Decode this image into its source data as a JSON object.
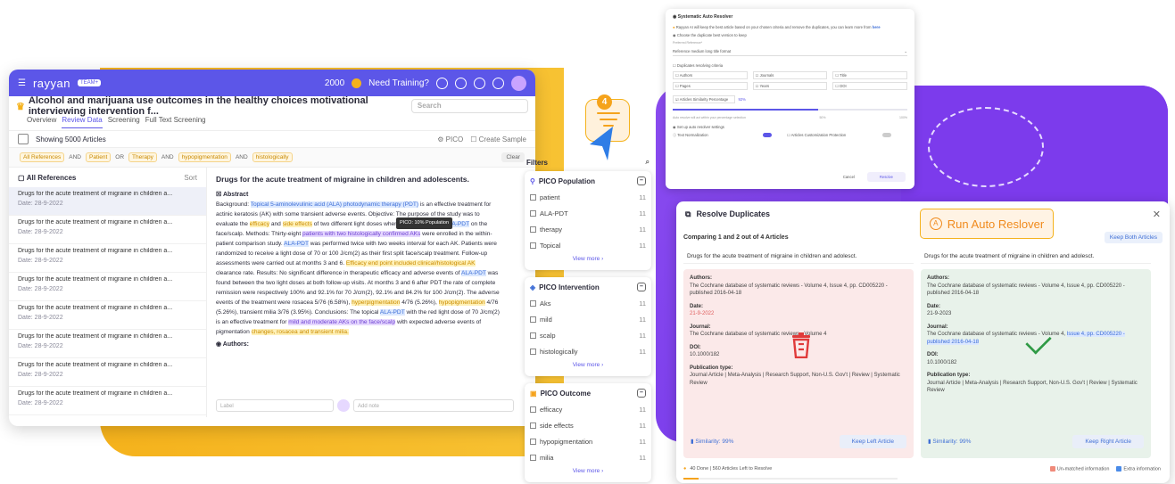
{
  "app": {
    "brand": "rayyan",
    "badge": "TEAM+",
    "coins": "2000",
    "training": "Need Training?",
    "review_title": "Alcohol and marijuana use outcomes in the healthy choices motivational interviewing intervention f...",
    "search_placeholder": "Search",
    "tabs": [
      "Overview",
      "Review Data",
      "Screening",
      "Full Text Screening"
    ],
    "showing": "Showing 5000 Articles",
    "pico_btn": "PICO",
    "create_sample": "Create Sample",
    "filters_chips": [
      "All References",
      "Patient",
      "Therapy",
      "hypopigmentation",
      "histologically"
    ],
    "ops": [
      "AND",
      "OR",
      "AND",
      "AND"
    ],
    "clear": "Clear",
    "all_refs": "All References",
    "sort": "Sort",
    "articles": [
      {
        "title": "Drugs for the acute treatment of migraine in children a...",
        "date": "Date: 28-9-2022"
      },
      {
        "title": "Drugs for the acute treatment of migraine in children a...",
        "date": "Date: 28-9-2022"
      },
      {
        "title": "Drugs for the acute treatment of migraine in children a...",
        "date": "Date: 28-9-2022"
      },
      {
        "title": "Drugs for the acute treatment of migraine in children a...",
        "date": "Date: 28-9-2022"
      },
      {
        "title": "Drugs for the acute treatment of migraine in children a...",
        "date": "Date: 28-9-2022"
      },
      {
        "title": "Drugs for the acute treatment of migraine in children a...",
        "date": "Date: 28-9-2022"
      },
      {
        "title": "Drugs for the acute treatment of migraine in children a...",
        "date": "Date: 28-9-2022"
      },
      {
        "title": "Drugs for the acute treatment of migraine in children a...",
        "date": "Date: 28-9-2022"
      }
    ],
    "detail_title": "Drugs for the acute treatment of migraine in children and adolescents.",
    "abstract_label": "Abstract",
    "tooltip": "PICO: 10% Population",
    "authors_label": "Authors:",
    "label_placeholder": "Label",
    "note_placeholder": "Add note",
    "abstract": {
      "p1": "Background: ",
      "h1": "Topical 5-aminolevulinic acid (ALA) photodynamic therapy (PDT)",
      "p2": " is an effective treatment for actinic keratosis (AK) with some transient adverse events. Objective: The purpose of the study was to evaluate the ",
      "h2": "efficacy",
      "p3": " and ",
      "h3": "side effects",
      "p4": " of two different light doses when treating AKs with ",
      "h4": "ALA-PDT",
      "p5": " on the face/scalp. Methods: Thirty-eight ",
      "h5": "patients with two histologically confirmed AKs",
      "p6": " were enrolled in the within-patient comparison study. ",
      "h6": "ALA-PDT",
      "p7": " was performed twice with two weeks interval for each AK. Patients were randomized to receive a light dose of 70 or 100 J/cm(2) as their first split face/scalp treatment. Follow-up assessments were carried out at months 3 and 6. ",
      "h7": "Efficacy end point included clinical/histological AK",
      "p8": " clearance rate. Results: No significant difference in therapeutic efficacy and adverse events of ",
      "h8": "ALA-PDT",
      "p9": " was found between the two light doses at both follow-up visits. At months 3 and 6 after PDT the rate of complete remission were respectively 100% and 92.1% for 70 J/cm(2), 92.1% and 84.2% for 100 J/cm(2). The adverse events of the treatment were rosacea 5/76 (6.58%), ",
      "h9": "hyperpigmentation",
      "p10": " 4/76 (5.26%), ",
      "h10": "hypopigmentation",
      "p11": " 4/76 (5.26%), transient milia 3/76 (3.95%). Conclusions: The topical ",
      "h11": "ALA-PDT",
      "p12": " with the red light dose of 70 J/cm(2) is an effective treatment for ",
      "h12": "mild and moderate AKs on the face/scalp",
      "p13": " with expected adverse events of pigmentation ",
      "h13": "changes, rosacea and transient milia."
    },
    "filters_title": "Filters",
    "pico_cards": [
      {
        "title": "PICO Population",
        "items": [
          {
            "label": "patient",
            "n": "11"
          },
          {
            "label": "ALA-PDT",
            "n": "11"
          },
          {
            "label": "therapy",
            "n": "11"
          },
          {
            "label": "Topical",
            "n": "11"
          }
        ],
        "more": "View more"
      },
      {
        "title": "PICO Intervention",
        "items": [
          {
            "label": "Aks",
            "n": "11"
          },
          {
            "label": "mild",
            "n": "11"
          },
          {
            "label": "scalp",
            "n": "11"
          },
          {
            "label": "histologically",
            "n": "11"
          }
        ],
        "more": "View more"
      },
      {
        "title": "PICO Outcome",
        "items": [
          {
            "label": "efficacy",
            "n": "11"
          },
          {
            "label": "side effects",
            "n": "11"
          },
          {
            "label": "hypopigmentation",
            "n": "11"
          },
          {
            "label": "milia",
            "n": "11"
          }
        ],
        "more": "View more"
      }
    ],
    "step_number": "4"
  },
  "resolver": {
    "title": "Systematic Auto Resolver",
    "info": "Rayyan AI will keep the best article based on your chosen criteria and remove the duplicates, you can learn more from",
    "info_link": "here",
    "choose": "Choose the duplicate best version to keep",
    "pref_label": "Preferred Reference*",
    "pref_value": "Reference medium long title format",
    "criteria_label": "Duplicates resolving criteria",
    "criteria": [
      "Authors",
      "Journals",
      "Title",
      "Pages",
      "Years",
      "DOI"
    ],
    "similarity_label": "Articles Similarity Percentage",
    "similarity_value": "92%",
    "slider_pct": 0.62,
    "slider_note": "Auto resolve will act within your percentage selection",
    "ticks": [
      "",
      "50%",
      "100%"
    ],
    "auto_label": "Set up auto resolver settings",
    "text_norm": "Text Normalization",
    "customization": "Articles Customization Protection",
    "cancel": "Cancel",
    "resolve": "Resolve"
  },
  "duplicates": {
    "title": "Resolve Duplicates",
    "run_btn": "Run Auto Reslover",
    "run_letter": "A",
    "comparing": "Comparing 1 and 2 out of 4 Articles",
    "keep_both": "Keep Both Articles",
    "left": {
      "title": "Drugs for the acute treatment of migraine in children and adolesct.",
      "authors_label": "Authors:",
      "authors": "The Cochrane database of systematic reviews - Volume 4, Issue 4, pp. CD005220 - published 2016-04-18",
      "date_label": "Date:",
      "date": "21-9-2022",
      "journal_label": "Journal:",
      "journal": "The Cochrane database of systematic reviews - Volume 4",
      "doi_label": "DOI:",
      "doi": "10.1000/182",
      "pub_label": "Publication type:",
      "pub": "Journal Article | Meta-Analysis | Research Support, Non-U.S. Gov't | Review | Systematic Review",
      "similarity": "Similarity: 99%",
      "keep": "Keep Left Article"
    },
    "right": {
      "title": "Drugs for the acute treatment of migraine in children and adolesct.",
      "authors_label": "Authors:",
      "authors": "The Cochrane database of systematic reviews - Volume 4, Issue 4, pp. CD005220 - published 2016-04-18",
      "date_label": "Date:",
      "date": "21-9-2023",
      "journal_label": "Journal:",
      "journal": "The Cochrane database of systematic reviews - Volume 4, ",
      "journal_hl": "Issue 4, pp. CD005220 - published 2016-04-18",
      "doi_label": "DOI:",
      "doi": "10.1000/182",
      "pub_label": "Publication type:",
      "pub": "Journal Article | Meta-Analysis | Research Support, Non-U.S. Gov't | Review | Systematic Review",
      "similarity": "Similarity: 99%",
      "keep": "Keep Right Article"
    },
    "progress": "40 Done | 560 Articles Left to Resolve",
    "progress_pct": 0.07,
    "legend_unmatched": "Un-matched information",
    "legend_extra": "Extra information",
    "colors": {
      "unmatched": "#f08a7a",
      "extra": "#4a8be8"
    }
  }
}
